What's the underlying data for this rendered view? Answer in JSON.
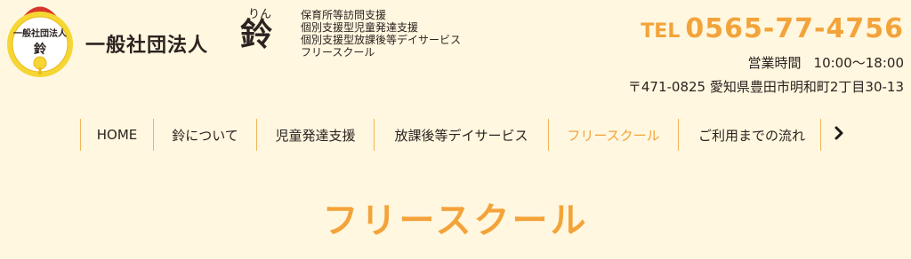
{
  "logo": {
    "text": "一般社団法人",
    "char": "鈴"
  },
  "header": {
    "org_name": "一般社団法人",
    "name_ruby": "りん",
    "name_kanji": "鈴",
    "services": [
      "保育所等訪問支援",
      "個別支援型児童発達支援",
      "個別支援型放課後等デイサービス",
      "フリースクール"
    ]
  },
  "contact": {
    "tel_label": "TEL",
    "tel_number": "0565-77-4756",
    "hours_label": "営業時間",
    "hours_value": "10:00～18:00",
    "address": "〒471-0825 愛知県豊田市明和町2丁目30-13"
  },
  "nav": {
    "items": [
      {
        "label": "HOME"
      },
      {
        "label": "鈴について"
      },
      {
        "label": "児童発達支援"
      },
      {
        "label": "放課後等デイサービス"
      },
      {
        "label": "フリースクール",
        "active": true
      },
      {
        "label": "ご利用までの流れ"
      }
    ],
    "next_icon": "chevron-right-icon"
  },
  "page": {
    "title": "フリースクール"
  },
  "colors": {
    "accent": "#f3a33a",
    "background": "#fff7df",
    "text": "#2b2320",
    "logo_yellow": "#f6d632",
    "logo_red": "#d9362b"
  }
}
